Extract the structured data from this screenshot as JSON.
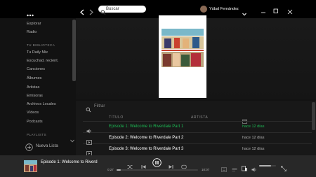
{
  "titlebar": {
    "menu_icon": "ellipsis-icon",
    "back_icon": "chevron-left-icon",
    "forward_icon": "chevron-right-icon",
    "search_placeholder": "Buscar",
    "user_name": "Yúbal Fernández",
    "dropdown_icon": "chevron-down-icon",
    "window_controls": [
      "minimize-icon",
      "maximize-icon",
      "close-icon"
    ]
  },
  "sidebar": {
    "nav": [
      "Explorar",
      "Radio"
    ],
    "library_heading": "TU BIBLIOTECA",
    "library_items": [
      "Tu Daily Mix",
      "Escuchad. recient.",
      "Canciones",
      "Álbumes",
      "Artistas",
      "Emisoras",
      "Archivos Locales",
      "Vídeos",
      "Podcasts"
    ],
    "playlists_heading": "PLAYLISTS",
    "new_list_label": "Nueva Lista"
  },
  "tracklist": {
    "filter_placeholder": "Filtrar",
    "columns": {
      "title": "TÍTULO",
      "artist": "ARTISTA",
      "date_icon": "calendar-icon"
    },
    "rows": [
      {
        "title": "Episode 1: Welcome to Riverdale Part 1",
        "date": "hace 12 días",
        "playing": true,
        "icon": "speaker-icon"
      },
      {
        "title": "Episode 2: Welcome to Riverdale Part 2",
        "date": "hace 12 días",
        "playing": false,
        "icon": "video-icon"
      },
      {
        "title": "Episode 3: Welcome to Riverdale Part 3",
        "date": "hace 12 días",
        "playing": false,
        "icon": "video-icon"
      }
    ]
  },
  "player": {
    "now_playing": "Episode 1: Welcome to Riverd",
    "elapsed": "0:27",
    "duration": "10:07",
    "progress": 0.05,
    "volume": 0.7
  },
  "colors": {
    "accent": "#1db954",
    "background": "#121212",
    "player": "#282828"
  }
}
